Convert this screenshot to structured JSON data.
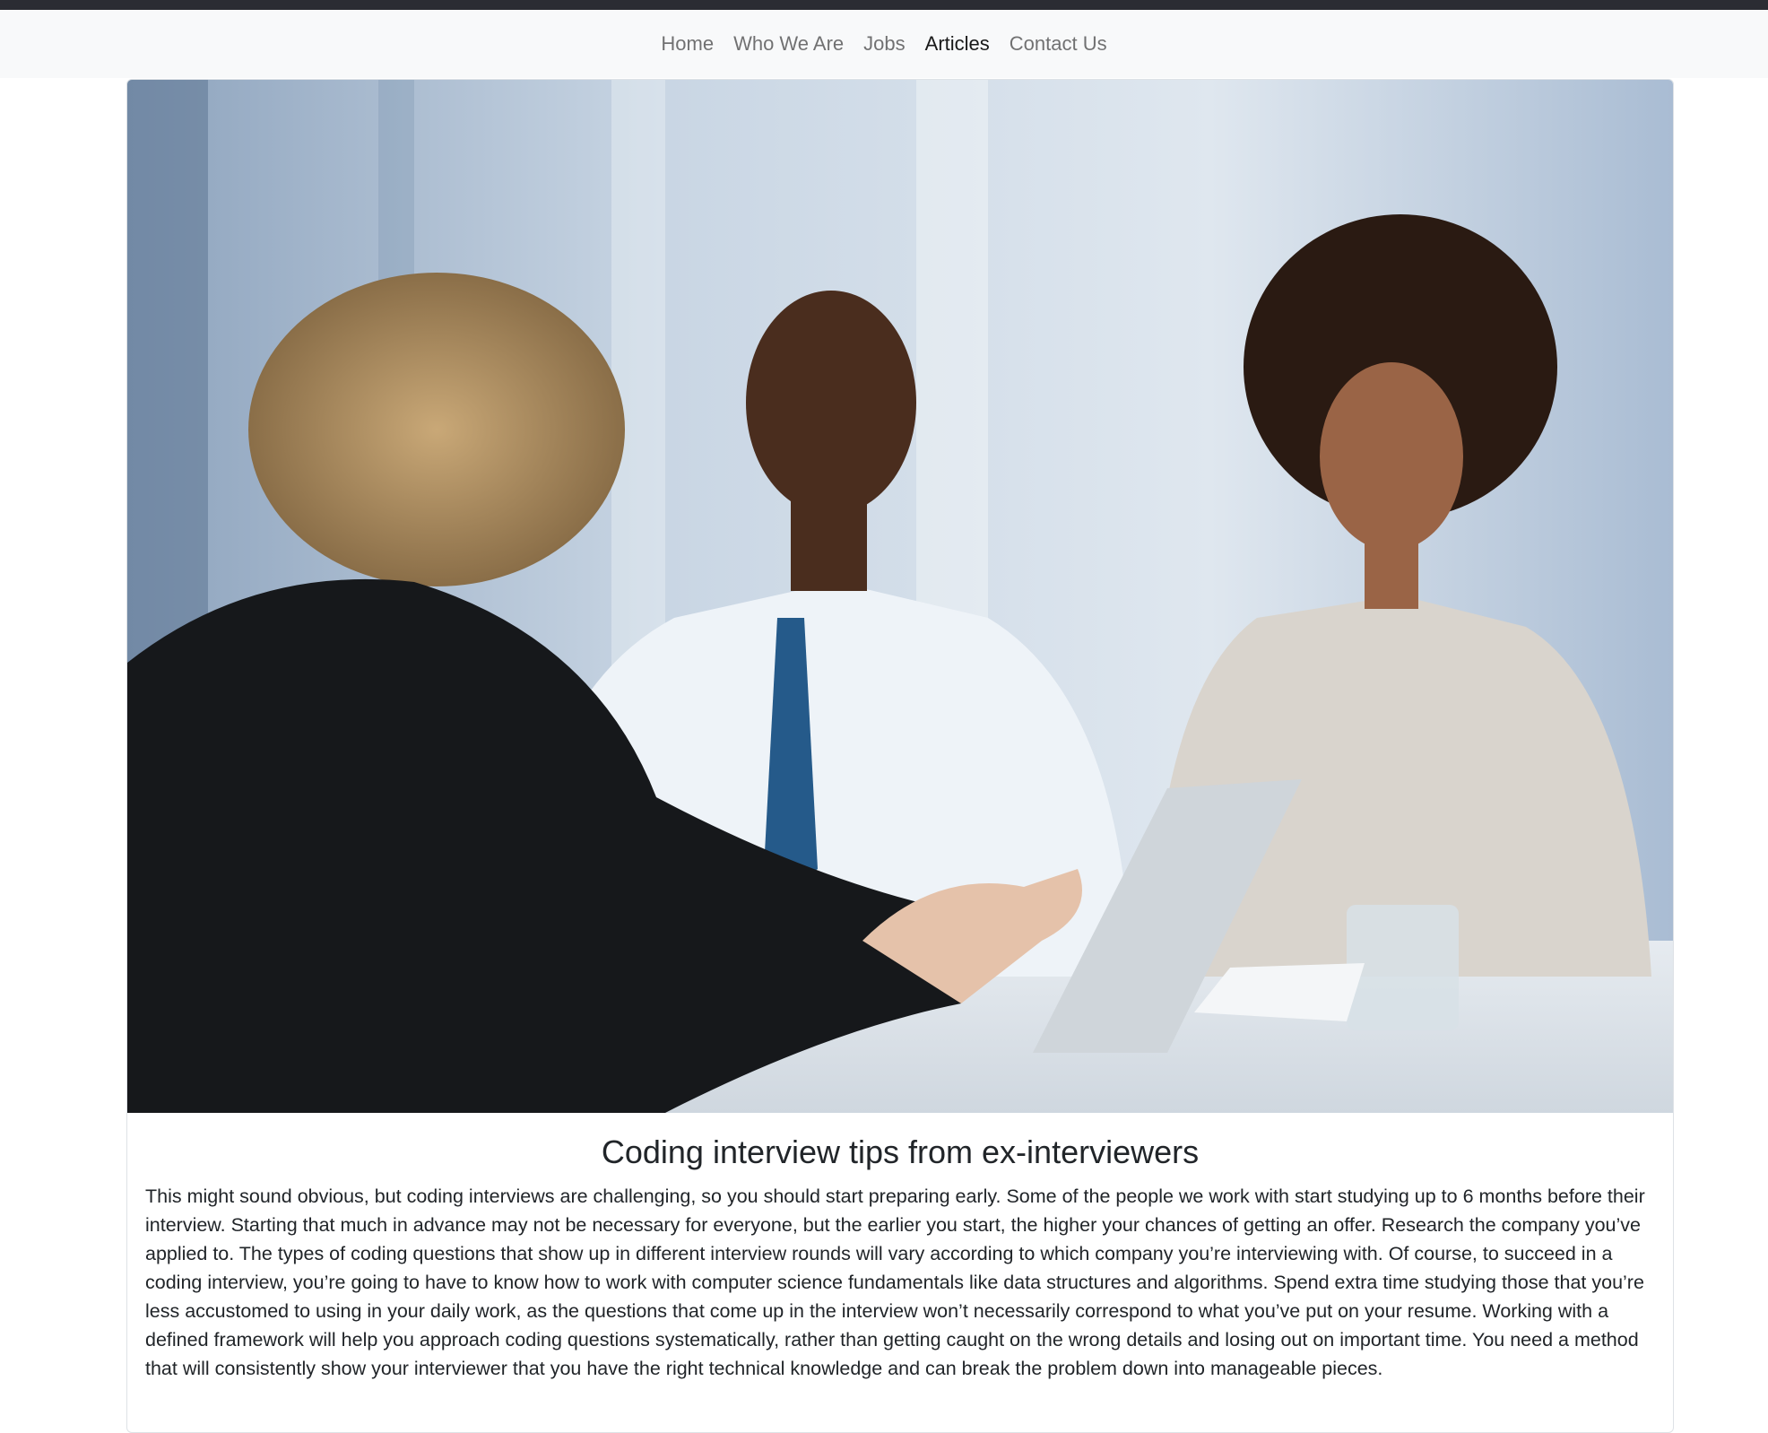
{
  "nav": {
    "items": [
      {
        "label": "Home",
        "active": false
      },
      {
        "label": "Who We Are",
        "active": false
      },
      {
        "label": "Jobs",
        "active": false
      },
      {
        "label": "Articles",
        "active": true
      },
      {
        "label": "Contact Us",
        "active": false
      }
    ]
  },
  "article": {
    "title": "Coding interview tips from ex-interviewers",
    "body": "This might sound obvious, but coding interviews are challenging, so you should start preparing early. Some of the people we work with start studying up to 6 months before their interview. Starting that much in advance may not be necessary for everyone, but the earlier you start, the higher your chances of getting an offer. Research the company you’ve applied to. The types of coding questions that show up in different interview rounds will vary according to which company you’re interviewing with. Of course, to succeed in a coding interview, you’re going to have to know how to work with computer science fundamentals like data structures and algorithms. Spend extra time studying those that you’re less accustomed to using in your daily work, as the questions that come up in the interview won’t necessarily correspond to what you’ve put on your resume. Working with a defined framework will help you approach coding questions systematically, rather than getting caught on the wrong details and losing out on important time. You need a method that will consistently show your interviewer that you have the right technical knowledge and can break the problem down into manageable pieces."
  },
  "colors": {
    "topbar": "#2b2c33",
    "nav_bg": "#f8f9fa",
    "nav_link": "#6c757d",
    "nav_active": "#212529"
  }
}
